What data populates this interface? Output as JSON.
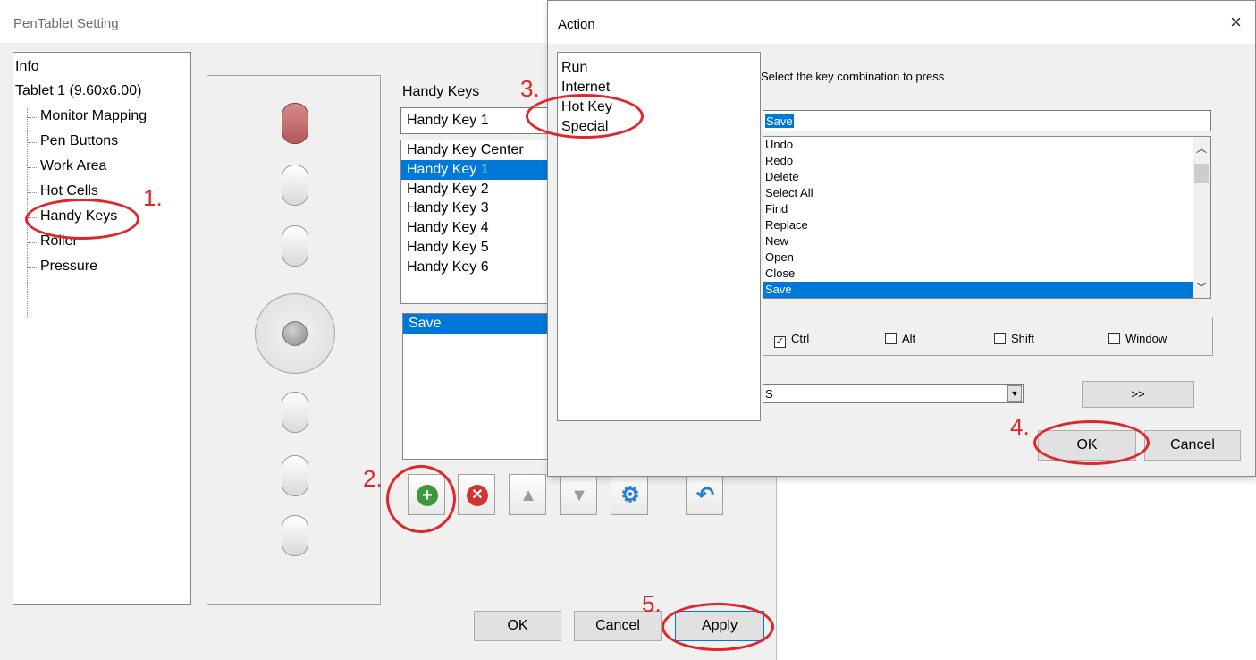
{
  "main_window": {
    "title": "PenTablet Setting",
    "tree": {
      "items": [
        "Info",
        "Tablet  1 (9.60x6.00)"
      ],
      "children": [
        "Monitor Mapping",
        "Pen Buttons",
        "Work Area",
        "Hot Cells",
        "Handy Keys",
        "Roller",
        "Pressure"
      ]
    },
    "handy_keys": {
      "label": "Handy Keys",
      "selected": "Handy Key 1",
      "list": [
        "Handy Key Center",
        "Handy Key 1",
        "Handy Key 2",
        "Handy Key 3",
        "Handy Key 4",
        "Handy Key 5",
        "Handy Key 6"
      ],
      "actions": [
        "Save"
      ]
    },
    "toolbar": [
      "add-icon",
      "remove-icon",
      "move-up-icon",
      "move-down-icon",
      "settings-icon",
      "undo-icon"
    ],
    "buttons": {
      "ok": "OK",
      "cancel": "Cancel",
      "apply": "Apply"
    }
  },
  "action_dialog": {
    "title": "Action",
    "close": "×",
    "types": [
      "Run",
      "Internet",
      "Hot Key",
      "Special"
    ],
    "combo_label": "Select the key combination to press",
    "combo_value": "Save",
    "key_list": [
      "Undo",
      "Redo",
      "Delete",
      "Select All",
      "Find",
      "Replace",
      "New",
      "Open",
      "Close",
      "Save"
    ],
    "modifiers": [
      {
        "label": "Ctrl",
        "checked": true
      },
      {
        "label": "Alt",
        "checked": false
      },
      {
        "label": "Shift",
        "checked": false
      },
      {
        "label": "Window",
        "checked": false
      }
    ],
    "key": "S",
    "more": ">>",
    "ok": "OK",
    "cancel": "Cancel"
  },
  "annotations": {
    "step1": "1.",
    "step2": "2.",
    "step3": "3.",
    "step4": "4.",
    "step5": "5."
  },
  "colors": {
    "selection": "#0078d7",
    "annotation": "#e0262a",
    "active_button": "#c06a6a"
  }
}
